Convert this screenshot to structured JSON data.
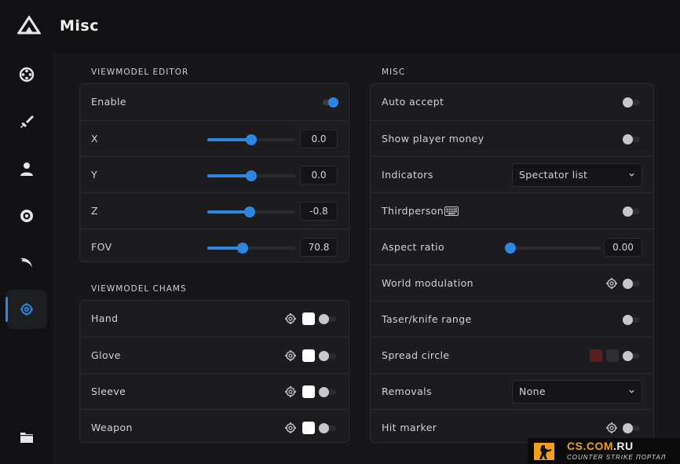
{
  "header": {
    "title": "Misc"
  },
  "sidebar": {
    "items": [
      {
        "icon": "crosshair-icon",
        "active": false
      },
      {
        "icon": "sword-icon",
        "active": false
      },
      {
        "icon": "user-icon",
        "active": false
      },
      {
        "icon": "eye-icon",
        "active": false
      },
      {
        "icon": "karambit-icon",
        "active": false
      },
      {
        "icon": "gear-icon",
        "active": true
      },
      {
        "icon": "folder-icon",
        "active": false
      }
    ]
  },
  "viewmodel_editor": {
    "title": "VIEWMODEL EDITOR",
    "enable": {
      "label": "Enable",
      "on": true
    },
    "sliders": [
      {
        "label": "X",
        "value": "0.0",
        "fraction": 0.5
      },
      {
        "label": "Y",
        "value": "0.0",
        "fraction": 0.5
      },
      {
        "label": "Z",
        "value": "-0.8",
        "fraction": 0.48
      },
      {
        "label": "FOV",
        "value": "70.8",
        "fraction": 0.4
      }
    ]
  },
  "viewmodel_chams": {
    "title": "VIEWMODEL CHAMS",
    "items": [
      {
        "label": "Hand",
        "color": "#ffffff",
        "on": false
      },
      {
        "label": "Glove",
        "color": "#ffffff",
        "on": false
      },
      {
        "label": "Sleeve",
        "color": "#ffffff",
        "on": false
      },
      {
        "label": "Weapon",
        "color": "#ffffff",
        "on": false
      }
    ]
  },
  "misc": {
    "title": "MISC",
    "auto_accept": {
      "label": "Auto accept",
      "on": false
    },
    "show_player_money": {
      "label": "Show player money",
      "on": false
    },
    "indicators": {
      "label": "Indicators",
      "selected": "Spectator list"
    },
    "thirdperson": {
      "label": "Thirdperson",
      "on": false
    },
    "aspect_ratio": {
      "label": "Aspect ratio",
      "value": "0.00",
      "fraction": 0.0
    },
    "world_modulation": {
      "label": "World modulation",
      "on": false
    },
    "taser_knife_range": {
      "label": "Taser/knife range",
      "on": false
    },
    "spread_circle": {
      "label": "Spread circle",
      "colors": [
        "#5a1f22",
        "#2e2e32"
      ],
      "on": false
    },
    "removals": {
      "label": "Removals",
      "selected": "None"
    },
    "hit_marker": {
      "label": "Hit marker",
      "on": false
    }
  },
  "colors": {
    "accent": "#2f86e0",
    "background": "#17171a",
    "panel": "#1c1c1f"
  },
  "watermark": {
    "domain_main": "CS.COM",
    "domain_tld": ".RU",
    "tagline": "COUNTER STRIKE ПОРТАЛ"
  }
}
